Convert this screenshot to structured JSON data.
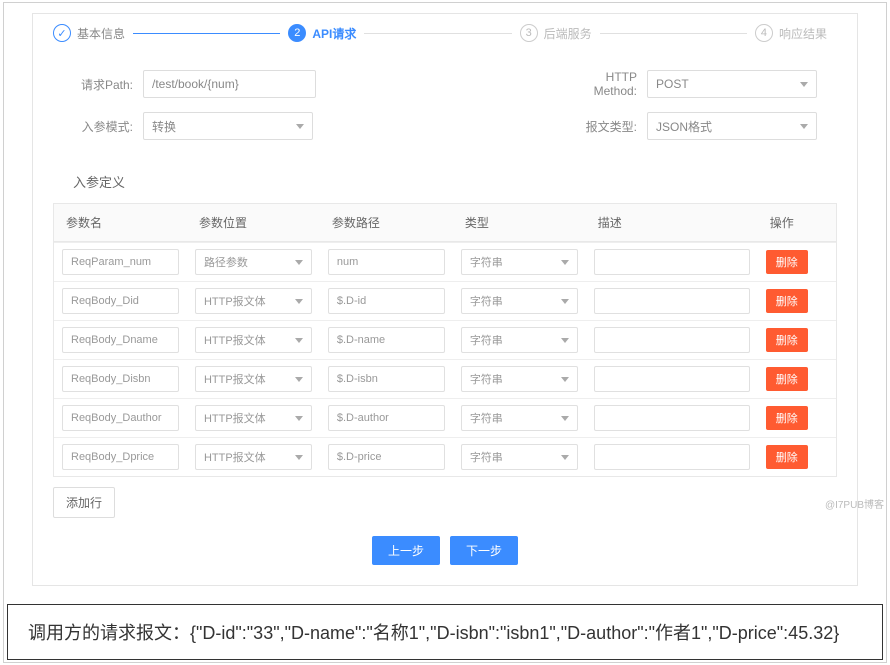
{
  "steps": [
    {
      "num": "",
      "label": "基本信息",
      "state": "done"
    },
    {
      "num": "2",
      "label": "API请求",
      "state": "active"
    },
    {
      "num": "3",
      "label": "后端服务",
      "state": "pending"
    },
    {
      "num": "4",
      "label": "响应结果",
      "state": "pending"
    }
  ],
  "form": {
    "path_label": "请求Path:",
    "path_value": "/test/book/{num}",
    "method_label": "HTTP Method:",
    "method_value": "POST",
    "mode_label": "入参模式:",
    "mode_value": "转换",
    "msgtype_label": "报文类型:",
    "msgtype_value": "JSON格式"
  },
  "section_title": "入参定义",
  "table": {
    "headers": [
      "参数名",
      "参数位置",
      "参数路径",
      "类型",
      "描述",
      "操作"
    ],
    "delete_label": "删除",
    "rows": [
      {
        "name": "ReqParam_num",
        "loc": "路径参数",
        "path": "num",
        "type": "字符串",
        "desc": ""
      },
      {
        "name": "ReqBody_Did",
        "loc": "HTTP报文体",
        "path": "$.D-id",
        "type": "字符串",
        "desc": ""
      },
      {
        "name": "ReqBody_Dname",
        "loc": "HTTP报文体",
        "path": "$.D-name",
        "type": "字符串",
        "desc": ""
      },
      {
        "name": "ReqBody_Disbn",
        "loc": "HTTP报文体",
        "path": "$.D-isbn",
        "type": "字符串",
        "desc": ""
      },
      {
        "name": "ReqBody_Dauthor",
        "loc": "HTTP报文体",
        "path": "$.D-author",
        "type": "字符串",
        "desc": ""
      },
      {
        "name": "ReqBody_Dprice",
        "loc": "HTTP报文体",
        "path": "$.D-price",
        "type": "字符串",
        "desc": ""
      }
    ]
  },
  "buttons": {
    "add_row": "添加行",
    "prev": "上一步",
    "next": "下一步"
  },
  "example_text": "调用方的请求报文：{\"D-id\":\"33\",\"D-name\":\"名称1\",\"D-isbn\":\"isbn1\",\"D-author\":\"作者1\",\"D-price\":45.32}",
  "watermark": "@I7PUB博客"
}
